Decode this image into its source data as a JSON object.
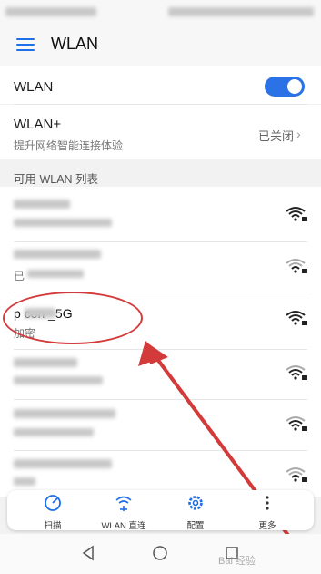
{
  "appbar": {
    "title": "WLAN"
  },
  "wlan": {
    "label": "WLAN",
    "enabled": true
  },
  "wlan_plus": {
    "title": "WLAN+",
    "subtitle": "提升网络智能连接体验",
    "status": "已关闭"
  },
  "section": {
    "title": "可用 WLAN 列表"
  },
  "networks": [
    {
      "name": "",
      "detail": "",
      "icon": "wifi-lock-icon"
    },
    {
      "name": "",
      "detail": "已",
      "icon": "wifi-lock-icon"
    },
    {
      "name": "p con  _5G",
      "detail": "加密",
      "icon": "wifi-lock-icon"
    },
    {
      "name": "",
      "detail": "",
      "icon": "wifi-lock-icon"
    },
    {
      "name": "",
      "detail": "",
      "icon": "wifi-lock-icon"
    },
    {
      "name": "",
      "detail": "",
      "icon": "wifi-lock-icon"
    }
  ],
  "toolbar": {
    "scan_label": "扫描",
    "direct_label": "WLAN 直连",
    "config_label": "配置",
    "more_label": "更多"
  },
  "colors": {
    "accent": "#2a72e5",
    "annotation": "#d33b3b"
  },
  "watermark": "Bai 经验"
}
